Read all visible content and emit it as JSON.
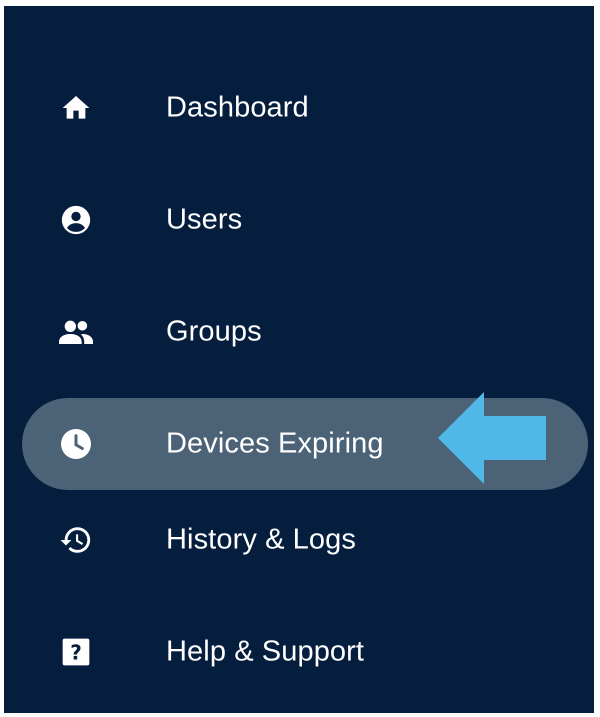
{
  "sidebar": {
    "items": [
      {
        "label": "Dashboard",
        "icon": "home-icon"
      },
      {
        "label": "Users",
        "icon": "user-circle-icon"
      },
      {
        "label": "Groups",
        "icon": "group-icon"
      },
      {
        "label": "Devices Expiring",
        "icon": "clock-icon",
        "active": true
      },
      {
        "label": "History & Logs",
        "icon": "history-icon"
      },
      {
        "label": "Help & Support",
        "icon": "help-icon"
      }
    ]
  },
  "annotation": {
    "arrow_color": "#4fb8e8",
    "points_to": "Devices Expiring"
  },
  "colors": {
    "sidebar_bg": "#061e3d",
    "active_bg": "#4c6277",
    "text": "#ffffff"
  }
}
